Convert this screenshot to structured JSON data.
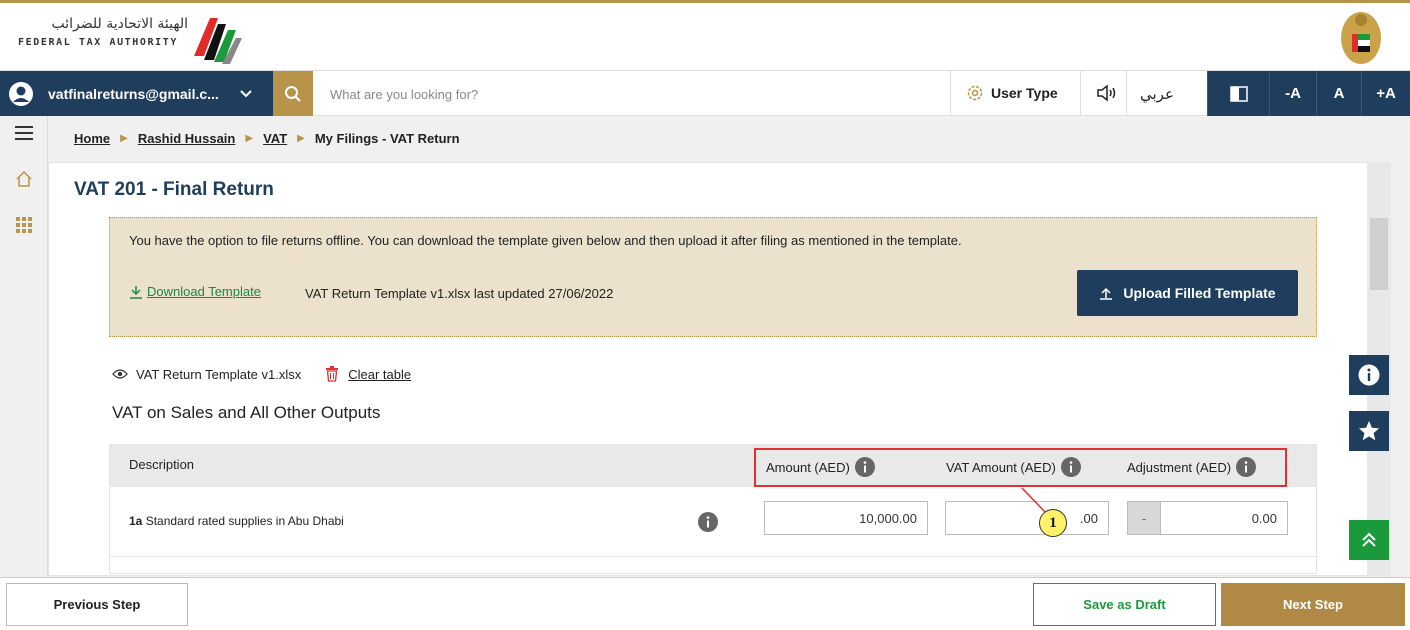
{
  "header": {
    "logo_arabic": "الهيئة الاتحادية للضرائب",
    "logo_english": "FEDERAL TAX AUTHORITY"
  },
  "navbar": {
    "account_email": "vatfinalreturns@gmail.c...",
    "search_placeholder": "What are you looking for?",
    "user_type_label": "User Type",
    "language_link": "عربي",
    "font_decrease": "-A",
    "font_normal": "A",
    "font_increase": "+A"
  },
  "breadcrumb": {
    "items": [
      "Home",
      "Rashid Hussain",
      "VAT"
    ],
    "current": "My Filings - VAT Return"
  },
  "page": {
    "title": "VAT 201 - Final Return"
  },
  "offline": {
    "message": "You have the option to file returns offline. You can download the template given below and then upload it after filing as mentioned in the template.",
    "download_label": "Download Template",
    "template_info": "VAT Return Template v1.xlsx last updated 27/06/2022",
    "upload_label": "Upload Filled Template"
  },
  "file": {
    "name": "VAT Return Template v1.xlsx",
    "clear_label": "Clear table"
  },
  "section": {
    "title": "VAT on Sales and All Other Outputs"
  },
  "table": {
    "headers": {
      "description": "Description",
      "amount": "Amount (AED)",
      "vat_amount": "VAT Amount (AED)",
      "adjustment": "Adjustment (AED)"
    },
    "rows": [
      {
        "code": "1a",
        "label": "Standard rated supplies in Abu Dhabi",
        "amount": "10,000.00",
        "vat_amount": ".00",
        "adjustment_sign": "-",
        "adjustment": "0.00"
      }
    ]
  },
  "annotation": {
    "callout_number": "1"
  },
  "footer": {
    "previous_label": "Previous Step",
    "draft_label": "Save as Draft",
    "next_label": "Next Step"
  },
  "colors": {
    "navy": "#1f3d5c",
    "gold": "#b8934a",
    "green": "#1a9a3a",
    "highlight_red": "#e03030"
  },
  "icons": [
    "user-avatar-icon",
    "chevron-down-icon",
    "search-icon",
    "gear-icon",
    "speaker-icon",
    "contrast-icon",
    "menu-icon",
    "home-icon",
    "grid-icon",
    "download-icon",
    "upload-icon",
    "eye-icon",
    "trash-icon",
    "info-icon",
    "star-icon",
    "double-chevron-up-icon"
  ]
}
